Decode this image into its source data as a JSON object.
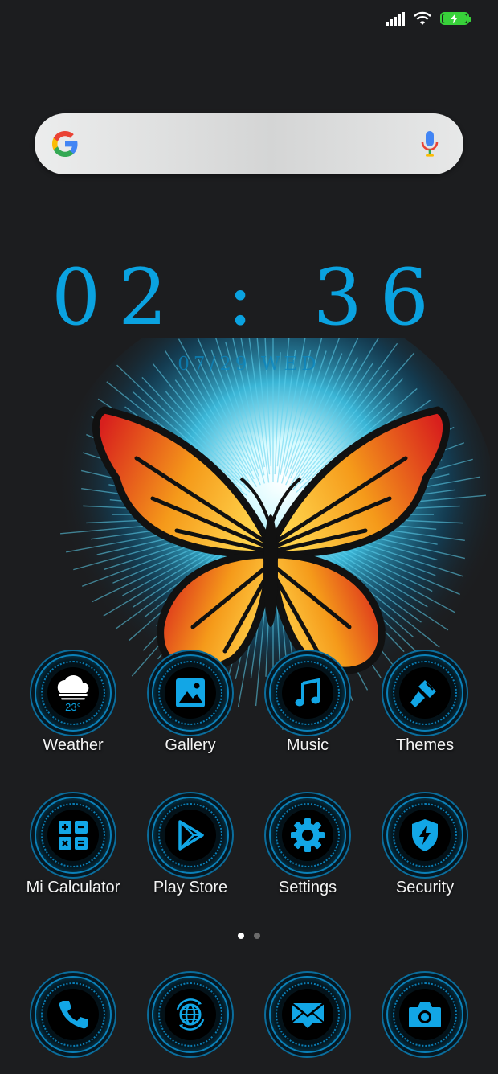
{
  "status_bar": {
    "signal_icon": "cell-signal-icon",
    "wifi_icon": "wifi-icon",
    "battery_icon": "battery-charging-icon",
    "battery_color": "#38d13a"
  },
  "search": {
    "logo_icon": "google-g-icon",
    "mic_icon": "microphone-icon"
  },
  "clock": {
    "time": "02 : 36",
    "date": "07/29 WED"
  },
  "accent_color": "#0aa2e0",
  "apps_row1": [
    {
      "label": "Weather",
      "icon": "cloud-icon",
      "badge": "23°"
    },
    {
      "label": "Gallery",
      "icon": "image-icon"
    },
    {
      "label": "Music",
      "icon": "music-note-icon"
    },
    {
      "label": "Themes",
      "icon": "paintbrush-icon"
    }
  ],
  "apps_row2": [
    {
      "label": "Mi Calculator",
      "icon": "calculator-icon"
    },
    {
      "label": "Play Store",
      "icon": "play-store-icon"
    },
    {
      "label": "Settings",
      "icon": "gear-icon"
    },
    {
      "label": "Security",
      "icon": "shield-icon"
    }
  ],
  "page_indicator": {
    "pages": 2,
    "current": 1
  },
  "dock": [
    {
      "icon": "phone-icon"
    },
    {
      "icon": "browser-globe-icon"
    },
    {
      "icon": "mail-icon"
    },
    {
      "icon": "camera-icon"
    }
  ]
}
